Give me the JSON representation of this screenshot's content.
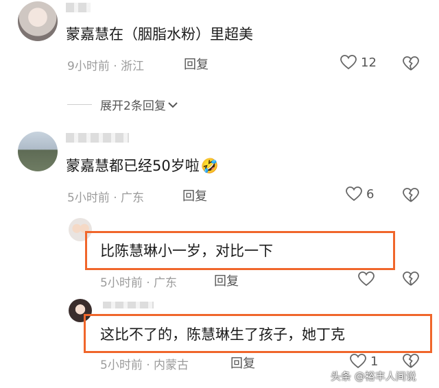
{
  "comments": [
    {
      "text": "蒙嘉慧在（胭脂水粉）里超美",
      "time_location": "9小时前 · 浙江",
      "reply_label": "回复",
      "like_count": "12"
    },
    {
      "text": "蒙嘉慧都已经50岁啦",
      "emoji": "🤣",
      "time_location": "5小时前 · 广东",
      "reply_label": "回复",
      "like_count": "6"
    }
  ],
  "expand_replies_label": "展开2条回复",
  "replies": [
    {
      "text": "比陈慧琳小一岁，对比一下",
      "time_location": "5小时前 · 广东",
      "reply_label": "回复"
    },
    {
      "text": "这比不了的，陈慧琳生了孩子，她丁克",
      "time_location": "5小时前 · 内蒙古",
      "reply_label": "回复",
      "like_count": "1"
    }
  ],
  "watermark": "头条 @裕丰人间说",
  "colors": {
    "highlight": "#f0662b",
    "meta": "#9b9b9b",
    "text": "#1a1a1a"
  }
}
